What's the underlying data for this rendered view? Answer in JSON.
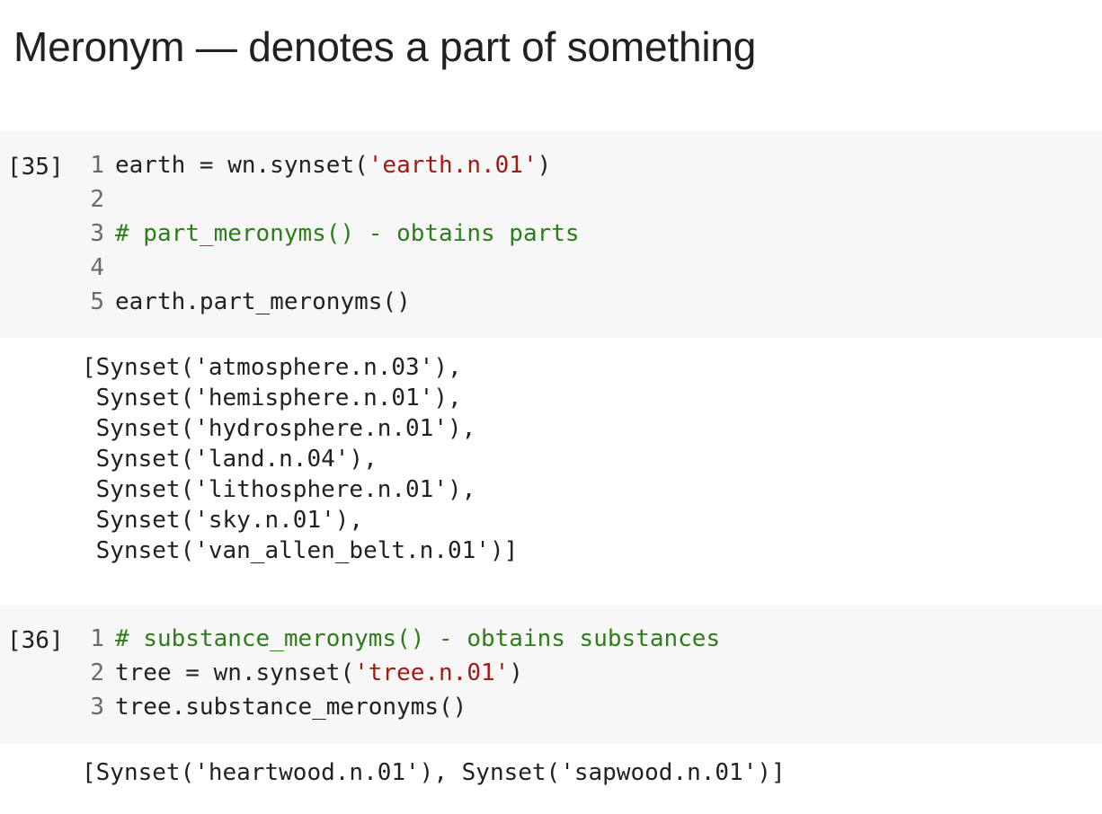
{
  "heading": "Meronym — denotes a part of something",
  "cells": [
    {
      "prompt": "[35]",
      "lines": [
        {
          "num": "1",
          "parts": [
            {
              "t": "earth = wn.synset(",
              "c": "tok"
            },
            {
              "t": "'earth.n.01'",
              "c": "str"
            },
            {
              "t": ")",
              "c": "tok"
            }
          ]
        },
        {
          "num": "2",
          "parts": []
        },
        {
          "num": "3",
          "parts": [
            {
              "t": "# part_meronyms() - obtains parts",
              "c": "com"
            }
          ]
        },
        {
          "num": "4",
          "parts": []
        },
        {
          "num": "5",
          "parts": [
            {
              "t": "earth.part_meronyms()",
              "c": "tok"
            }
          ]
        }
      ],
      "output": [
        "[Synset('atmosphere.n.03'),",
        " Synset('hemisphere.n.01'),",
        " Synset('hydrosphere.n.01'),",
        " Synset('land.n.04'),",
        " Synset('lithosphere.n.01'),",
        " Synset('sky.n.01'),",
        " Synset('van_allen_belt.n.01')]"
      ]
    },
    {
      "prompt": "[36]",
      "lines": [
        {
          "num": "1",
          "parts": [
            {
              "t": "# substance_meronyms() - obtains substances",
              "c": "com"
            }
          ]
        },
        {
          "num": "2",
          "parts": [
            {
              "t": "tree = wn.synset(",
              "c": "tok"
            },
            {
              "t": "'tree.n.01'",
              "c": "str"
            },
            {
              "t": ")",
              "c": "tok"
            }
          ]
        },
        {
          "num": "3",
          "parts": [
            {
              "t": "tree.substance_meronyms()",
              "c": "tok"
            }
          ]
        }
      ],
      "output": [
        "[Synset('heartwood.n.01'), Synset('sapwood.n.01')]"
      ]
    }
  ],
  "colors": {
    "cell_background": "#f7f7f7",
    "string": "#a11a16",
    "comment": "#2d7d1a",
    "line_number": "#6a6a6a",
    "text": "#212121"
  }
}
